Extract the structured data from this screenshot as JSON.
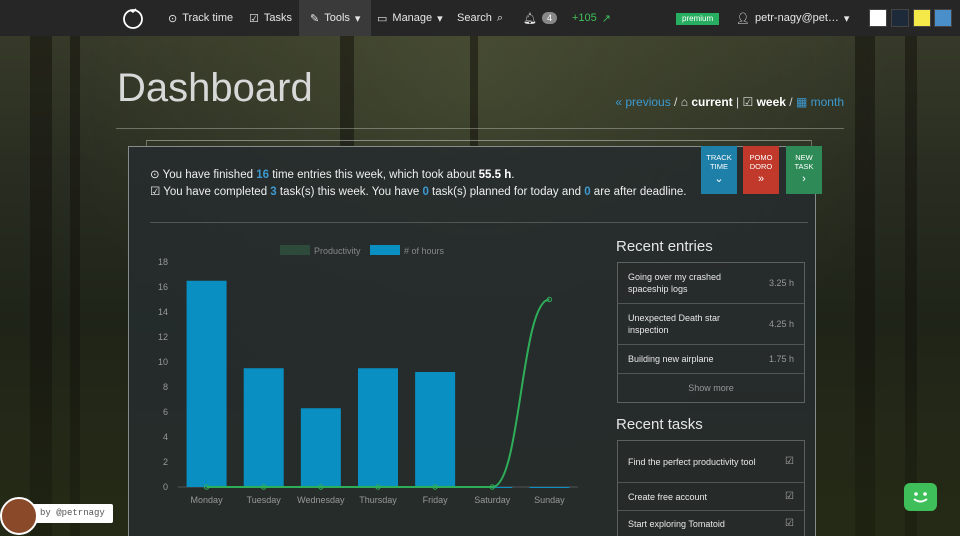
{
  "navbar": {
    "track_time": "Track time",
    "tasks": "Tasks",
    "tools": "Tools",
    "manage": "Manage",
    "search": "Search",
    "notification_count": "4",
    "points": "+105",
    "premium": "premium",
    "user": "petr-nagy@pet…",
    "swatches": [
      "#ffffff",
      "#1c2a3a",
      "#f5e94a",
      "#4a8fc9"
    ]
  },
  "header": {
    "title": "Dashboard",
    "previous": "« previous",
    "current": "current",
    "week": "week",
    "month": "month"
  },
  "summary": {
    "line1_a": "You have finished ",
    "entries": "16",
    "line1_b": " time entries this week, which took about ",
    "hours": "55.5 h",
    "line1_c": ".",
    "line2_a": "You have completed ",
    "completed": "3",
    "line2_b": " task(s) this week. You have ",
    "planned": "0",
    "line2_c": " task(s) planned for today and ",
    "overdue": "0",
    "line2_d": " are after deadline."
  },
  "actions": {
    "track": "TRACK TIME",
    "pomodoro": "POMO DORO",
    "new_task": "NEW TASK",
    "colors": {
      "track": "#1e7fa8",
      "pomodoro": "#c0392b",
      "new_task": "#2e8b57"
    }
  },
  "chart_data": {
    "type": "bar",
    "categories": [
      "Monday",
      "Tuesday",
      "Wednesday",
      "Thursday",
      "Friday",
      "Saturday",
      "Sunday"
    ],
    "series": [
      {
        "name": "# of hours",
        "type": "bar",
        "color": "#0a8fc2",
        "values": [
          16.5,
          9.5,
          6.3,
          9.5,
          9.2,
          0,
          0
        ]
      },
      {
        "name": "Productivity",
        "type": "line",
        "color": "#2fae5a",
        "values": [
          0,
          0,
          0,
          0,
          0,
          0,
          15
        ]
      }
    ],
    "ylim": [
      0,
      18
    ],
    "yticks": [
      0,
      2,
      4,
      6,
      8,
      10,
      12,
      14,
      16,
      18
    ],
    "legend": "top"
  },
  "recent_entries": {
    "title": "Recent entries",
    "items": [
      {
        "label": "Going over my crashed spaceship logs",
        "hours": "3.25 h"
      },
      {
        "label": "Unexpected Death star inspection",
        "hours": "4.25 h"
      },
      {
        "label": "Building new airplane",
        "hours": "1.75 h"
      }
    ],
    "show_more": "Show more"
  },
  "recent_tasks": {
    "title": "Recent tasks",
    "items": [
      {
        "label": "Find the perfect productivity tool"
      },
      {
        "label": "Create free account"
      },
      {
        "label": "Start exploring Tomatoid"
      }
    ]
  },
  "credit": {
    "label": "by @petrnagy"
  }
}
